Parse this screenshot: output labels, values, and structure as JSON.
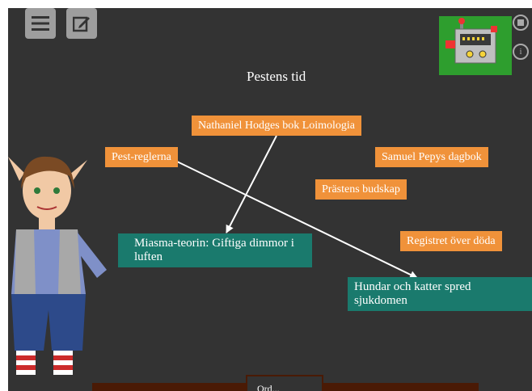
{
  "toolbar": {
    "menu_icon": "hamburger-icon",
    "edit_icon": "edit-icon"
  },
  "map": {
    "title": "Pestens tid",
    "nodes": [
      {
        "id": "hodges",
        "label": "Nathaniel Hodges bok Loimologia",
        "kind": "source"
      },
      {
        "id": "pest",
        "label": "Pest-reglerna",
        "kind": "source"
      },
      {
        "id": "pepys",
        "label": "Samuel Pepys dagbok",
        "kind": "source"
      },
      {
        "id": "prast",
        "label": "Prästens budskap",
        "kind": "source"
      },
      {
        "id": "register",
        "label": "Registret över döda",
        "kind": "source"
      },
      {
        "id": "miasma",
        "label": "Miasma-teorin: Giftiga dimmor i luften",
        "kind": "claim"
      },
      {
        "id": "hundar",
        "label": "Hundar och katter spred sjukdomen",
        "kind": "claim"
      }
    ],
    "links": [
      {
        "from": "hodges",
        "to": "miasma"
      },
      {
        "from": "pest",
        "to": "hundar"
      }
    ]
  },
  "bottom": {
    "label": "Ord..."
  },
  "colors": {
    "source": "#f0923a",
    "claim": "#1a7a6d",
    "background": "#333333",
    "robot_panel": "#2e9e2e"
  }
}
